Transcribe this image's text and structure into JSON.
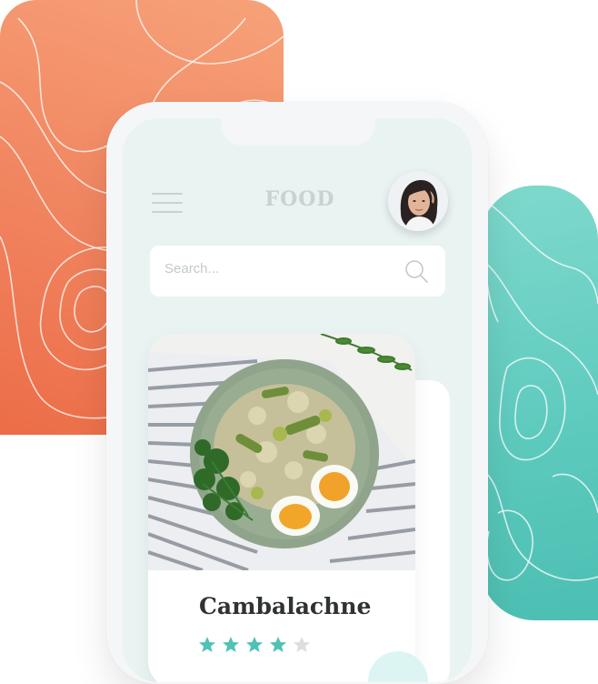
{
  "header": {
    "brand": "FOOD"
  },
  "search": {
    "placeholder": "Search..."
  },
  "food_item": {
    "name": "Cambalachne",
    "rating": 4,
    "rating_max": 5
  },
  "icons": {
    "menu": "hamburger-menu-icon",
    "search": "search-icon",
    "star_filled": "star-filled-icon",
    "star_empty": "star-empty-icon"
  },
  "colors": {
    "orange": "#f0845f",
    "teal": "#5cc9bd",
    "star_filled": "#4fc2b6",
    "star_empty": "#dcdfe0",
    "brand_text": "#c9d1d1",
    "title_text": "#2f3333"
  }
}
